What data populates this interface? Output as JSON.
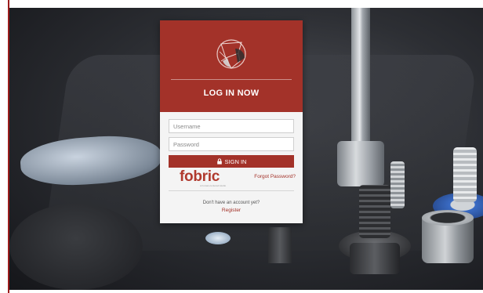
{
  "login": {
    "title": "LOG IN NOW",
    "username_placeholder": "Username",
    "password_placeholder": "Password",
    "signin_label": "SIGN IN",
    "forgot_label": "Forgot Password?",
    "no_account_text": "Don't have an account yet?",
    "register_label": "Register"
  },
  "brand": {
    "name": "fobric",
    "tagline": "a human-centered studio"
  },
  "icons": {
    "logo": "abstract-sphere-logo-icon",
    "signin": "lock-icon"
  },
  "colors": {
    "accent": "#a33229",
    "card_body": "#f4f4f4",
    "background": "#2d2f34"
  }
}
